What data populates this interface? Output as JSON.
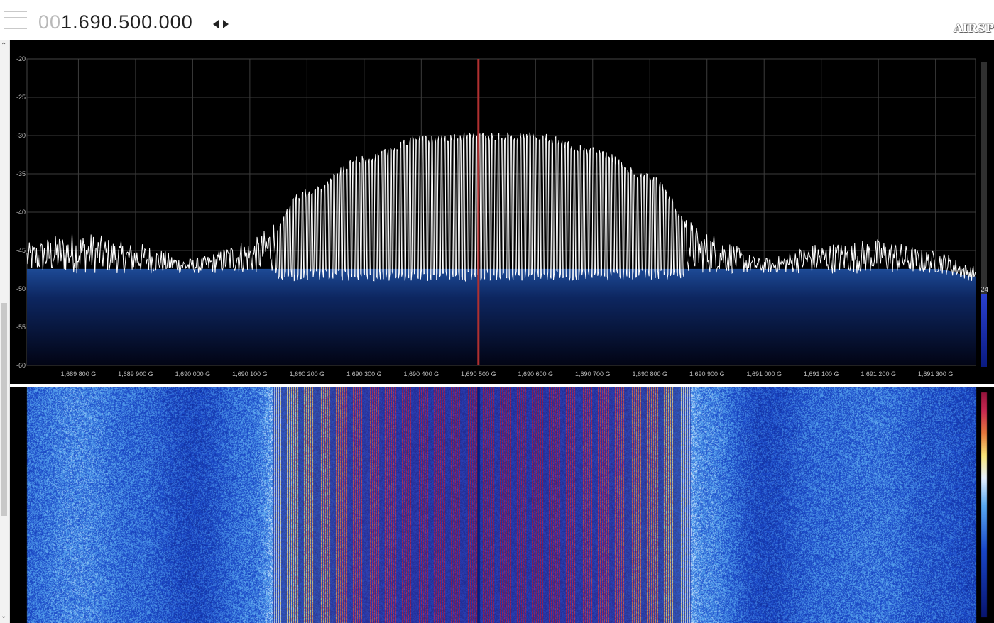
{
  "toolbar": {
    "frequency_leading": "00",
    "frequency_main": "1.690.500.000",
    "brand": "AIRSP"
  },
  "spectrum": {
    "y_ticks": [
      "-20",
      "-25",
      "-30",
      "-35",
      "-40",
      "-45",
      "-50",
      "-55",
      "-60"
    ],
    "x_ticks": [
      "1,689 800 G",
      "1,689 900 G",
      "1,690 000 G",
      "1,690 100 G",
      "1,690 200 G",
      "1,690 300 G",
      "1,690 400 G",
      "1,690 500 G",
      "1,690 600 G",
      "1,690 700 G",
      "1,690 800 G",
      "1,690 900 G",
      "1,691 000 G",
      "1,691 100 G",
      "1,691 200 G",
      "1,691 300 G"
    ],
    "level_label": "24",
    "colors": {
      "background": "#000000",
      "grid": "#3a3a3a",
      "trace": "#ffffff",
      "fill_top": "#1a3a7a",
      "fill_bottom": "#000010",
      "center_marker": "#b03030"
    }
  },
  "chart_data": {
    "type": "line",
    "title": "",
    "xlabel": "",
    "ylabel": "",
    "x_unit": "GHz",
    "xlim": [
      1.68971,
      1.69137
    ],
    "ylim": [
      -60,
      -20
    ],
    "center_frequency": 1.6905,
    "series": [
      {
        "x": [
          1.6897,
          1.6898,
          1.6899,
          1.69,
          1.6901,
          1.6902,
          1.6903,
          1.6904,
          1.6905,
          1.6906,
          1.6907,
          1.6908,
          1.6909,
          1.691,
          1.6911,
          1.6912,
          1.6913,
          1.69137
        ],
        "peak": [
          -45.5,
          -44,
          -45.5,
          -47.5,
          -45,
          -37,
          -32.5,
          -30,
          -29.5,
          -29.5,
          -31.5,
          -35,
          -44,
          -47.5,
          -45.5,
          -45,
          -46.5,
          -48.5
        ],
        "floor": [
          -48,
          -48,
          -48,
          -48,
          -48,
          -48,
          -48,
          -48,
          -48,
          -48,
          -48,
          -48,
          -48,
          -48,
          -48,
          -48,
          -48,
          -49
        ]
      }
    ]
  }
}
